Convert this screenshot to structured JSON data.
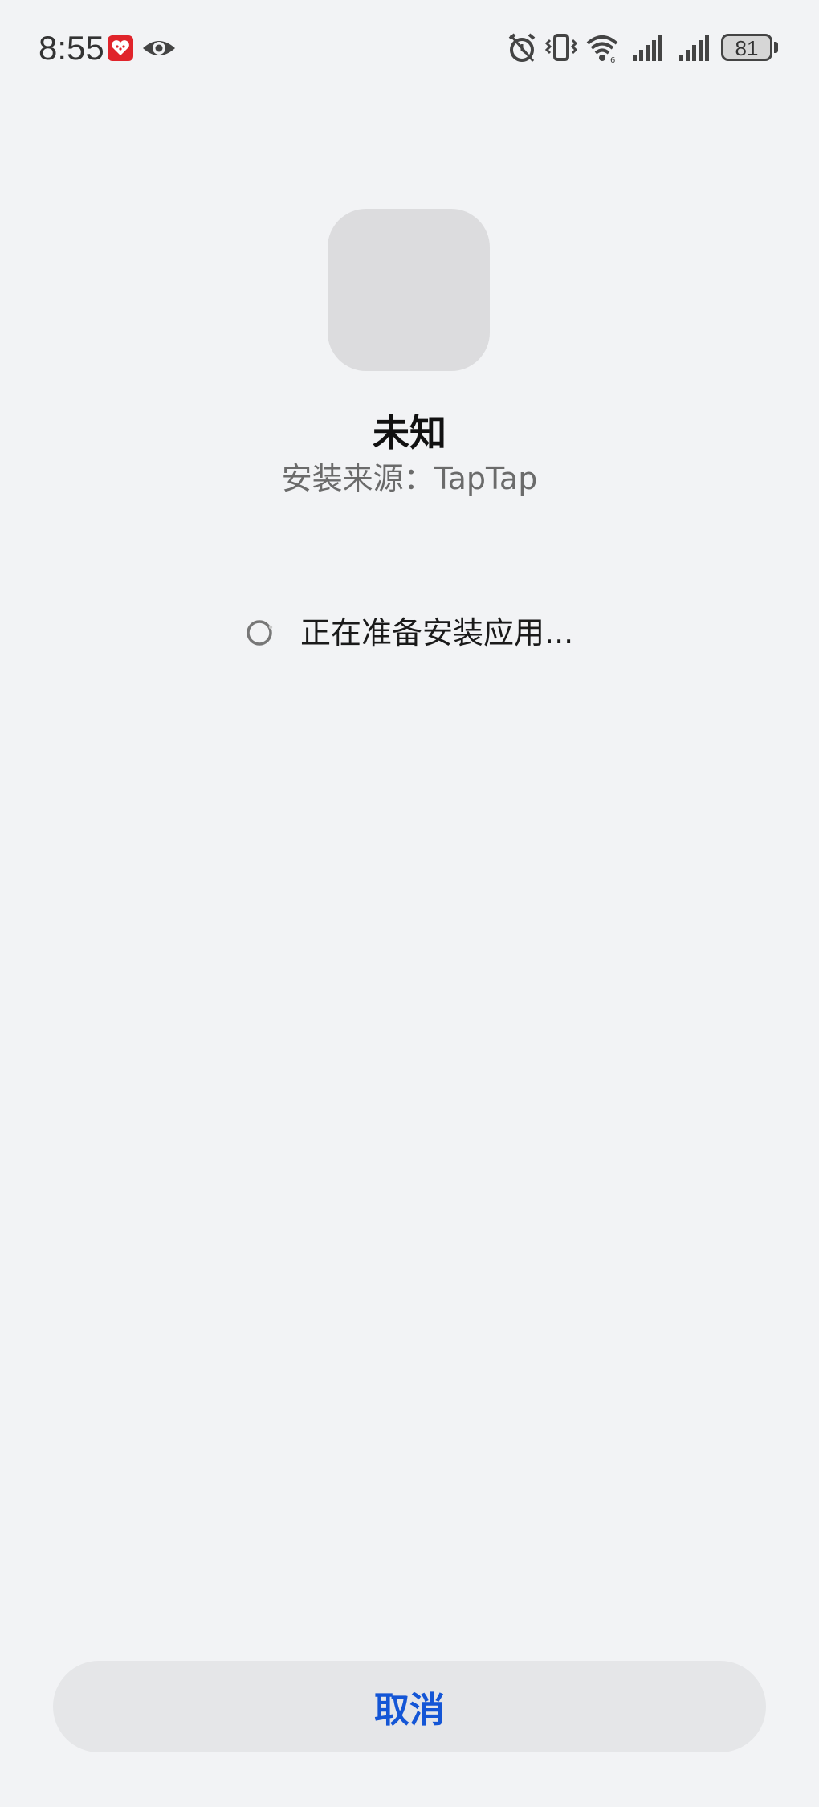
{
  "status_bar": {
    "time": "8:55",
    "left_icons": [
      "app-notification-icon",
      "eye-icon"
    ],
    "right_icons": [
      "alarm-icon",
      "vibrate-icon",
      "wifi-icon",
      "signal-icon",
      "signal-icon"
    ],
    "battery_level": "81"
  },
  "app": {
    "name": "未知",
    "source": "安装来源：TapTap"
  },
  "progress": {
    "text": "正在准备安装应用..."
  },
  "actions": {
    "cancel_label": "取消"
  },
  "colors": {
    "background": "#f2f3f5",
    "accent": "#1456d6",
    "button_bg": "#e5e6e8",
    "notification_red": "#e0242b"
  }
}
